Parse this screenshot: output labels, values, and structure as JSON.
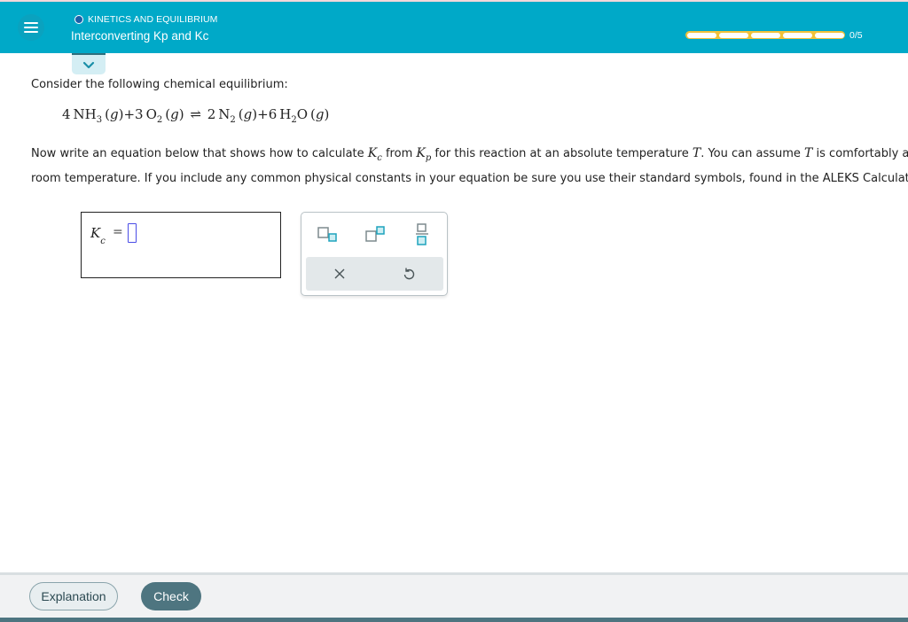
{
  "header": {
    "topic": "KINETICS AND EQUILIBRIUM",
    "title": "Interconverting Kp and Kc",
    "progress": {
      "completed": 0,
      "total": 5,
      "label": "0/5"
    },
    "colors": {
      "bar": "#00a9c8",
      "progress": "#f0c13a"
    }
  },
  "question": {
    "prompt": "Consider the following chemical equilibrium:",
    "reaction": {
      "reactants": [
        {
          "coef": "4",
          "formula": "NH",
          "sub": "3",
          "state": "g"
        },
        {
          "coef": "3",
          "formula": "O",
          "sub": "2",
          "state": "g"
        }
      ],
      "arrow": "⇌",
      "products": [
        {
          "coef": "2",
          "formula": "N",
          "sub": "2",
          "state": "g"
        },
        {
          "coef": "6",
          "formula": "H",
          "sub": "2",
          "formula2": "O",
          "state": "g"
        }
      ]
    },
    "instructions": {
      "line1_a": "Now write an equation below that shows how to calculate ",
      "kc_base": "K",
      "kc_sub": "c",
      "line1_b": " from ",
      "kp_base": "K",
      "kp_sub": "p",
      "line1_c": " for this reaction at an absolute temperature ",
      "T1": "T",
      "line1_d": ". You can assume ",
      "T2": "T",
      "line1_e": " is comfortably above",
      "line2": "room temperature. If you include any common physical constants in your equation be sure you use their standard symbols, found in the ALEKS Calculator."
    }
  },
  "answer": {
    "lhs_base": "K",
    "lhs_sub": "c",
    "equals": "=",
    "value": ""
  },
  "palette": {
    "buttons": [
      "subscript-icon",
      "superscript-icon",
      "fraction-icon"
    ],
    "actions": [
      "clear-icon",
      "undo-icon"
    ]
  },
  "footer": {
    "explanation_label": "Explanation",
    "check_label": "Check"
  }
}
